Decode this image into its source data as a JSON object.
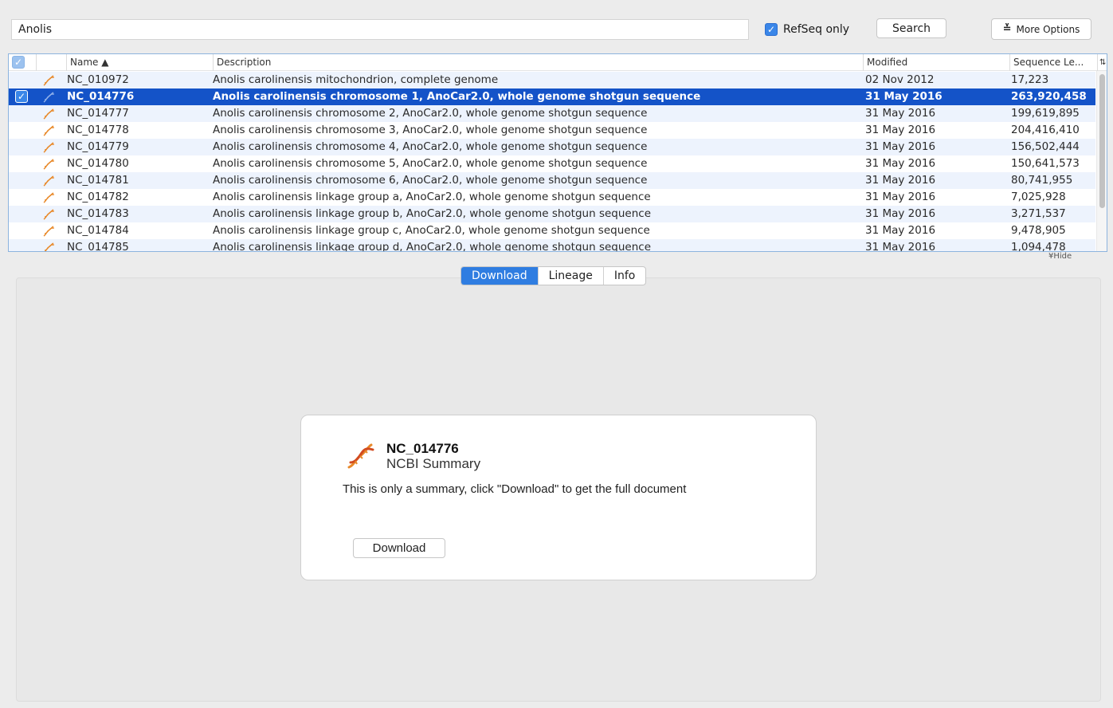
{
  "search": {
    "value": "Anolis",
    "refseq_label": "RefSeq only",
    "button_label": "Search",
    "more_options_label": "More Options"
  },
  "table": {
    "columns": [
      "Name ▲",
      "Description",
      "Modified",
      "Sequence Le..."
    ],
    "rows": [
      {
        "name": "NC_010972",
        "desc": "Anolis carolinensis mitochondrion, complete genome",
        "modified": "02 Nov 2012",
        "length": "17,223"
      },
      {
        "name": "NC_014776",
        "desc": "Anolis carolinensis chromosome 1, AnoCar2.0, whole genome shotgun sequence",
        "modified": "31 May 2016",
        "length": "263,920,458"
      },
      {
        "name": "NC_014777",
        "desc": "Anolis carolinensis chromosome 2, AnoCar2.0, whole genome shotgun sequence",
        "modified": "31 May 2016",
        "length": "199,619,895"
      },
      {
        "name": "NC_014778",
        "desc": "Anolis carolinensis chromosome 3, AnoCar2.0, whole genome shotgun sequence",
        "modified": "31 May 2016",
        "length": "204,416,410"
      },
      {
        "name": "NC_014779",
        "desc": "Anolis carolinensis chromosome 4, AnoCar2.0, whole genome shotgun sequence",
        "modified": "31 May 2016",
        "length": "156,502,444"
      },
      {
        "name": "NC_014780",
        "desc": "Anolis carolinensis chromosome 5, AnoCar2.0, whole genome shotgun sequence",
        "modified": "31 May 2016",
        "length": "150,641,573"
      },
      {
        "name": "NC_014781",
        "desc": "Anolis carolinensis chromosome 6, AnoCar2.0, whole genome shotgun sequence",
        "modified": "31 May 2016",
        "length": "80,741,955"
      },
      {
        "name": "NC_014782",
        "desc": "Anolis carolinensis linkage group a, AnoCar2.0, whole genome shotgun sequence",
        "modified": "31 May 2016",
        "length": "7,025,928"
      },
      {
        "name": "NC_014783",
        "desc": "Anolis carolinensis linkage group b, AnoCar2.0, whole genome shotgun sequence",
        "modified": "31 May 2016",
        "length": "3,271,537"
      },
      {
        "name": "NC_014784",
        "desc": "Anolis carolinensis linkage group c, AnoCar2.0, whole genome shotgun sequence",
        "modified": "31 May 2016",
        "length": "9,478,905"
      },
      {
        "name": "NC_014785",
        "desc": "Anolis carolinensis linkage group d, AnoCar2.0, whole genome shotgun sequence",
        "modified": "31 May 2016",
        "length": "1,094,478"
      }
    ],
    "selected_row": 1,
    "hide_label": "¥Hide"
  },
  "tabs": [
    "Download",
    "Lineage",
    "Info"
  ],
  "active_tab": 0,
  "summary": {
    "accession": "NC_014776",
    "subtitle": "NCBI Summary",
    "message": "This is only a summary, click \"Download\" to get the full document",
    "button_label": "Download"
  },
  "colors": {
    "selection": "#1453c8",
    "accent": "#2f7de1",
    "icon": "#e8892a"
  }
}
